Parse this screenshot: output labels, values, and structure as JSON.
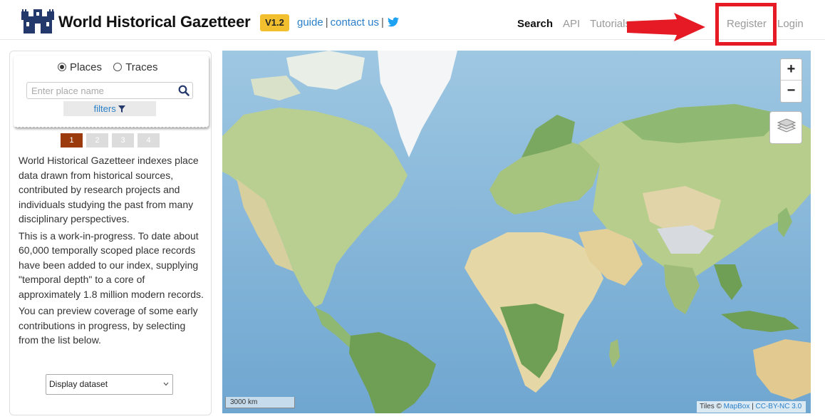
{
  "header": {
    "site_title": "World Historical Gazetteer",
    "version": "V1.2",
    "guide_label": "guide",
    "sep1": "|",
    "contact_label": "contact us",
    "sep2": "|",
    "twitter_icon": "twitter-icon"
  },
  "nav": {
    "search": "Search",
    "api": "API",
    "tutorials": "Tutorials",
    "register": "Register",
    "login": "Login"
  },
  "search_panel": {
    "radio_places": "Places",
    "radio_traces": "Traces",
    "selected": "Places",
    "placeholder": "Enter place name",
    "filters_label": "filters",
    "filter_icon": "funnel-icon"
  },
  "pager": [
    "1",
    "2",
    "3",
    "4"
  ],
  "description": {
    "p1": "World Historical Gazetteer indexes place data drawn from historical sources, contributed by research projects and individuals studying the past from many disciplinary perspectives.",
    "p2": "This is a work-in-progress. To date about 60,000 temporally scoped place records have been added to our index, supplying \"temporal depth\" to a core of approximately 1.8 million modern records.",
    "p3": "You can preview coverage of some early contributions in progress, by selecting from the list below."
  },
  "dataset_select": {
    "selected": "Display dataset"
  },
  "map": {
    "zoom_in": "+",
    "zoom_out": "−",
    "scale_label": "3000 km",
    "attribution_prefix": "Tiles ©",
    "attribution_mapbox": "MapBox",
    "attribution_sep": "|",
    "attribution_license": "CC-BY-NC 3.0"
  },
  "colors": {
    "accent_link": "#2a7fc8",
    "version_badge": "#f2c02e",
    "pager_active": "#9b3a0d",
    "annotation_red": "#e51a24",
    "ocean": "#86b9da",
    "land": "#c9d7a3"
  }
}
